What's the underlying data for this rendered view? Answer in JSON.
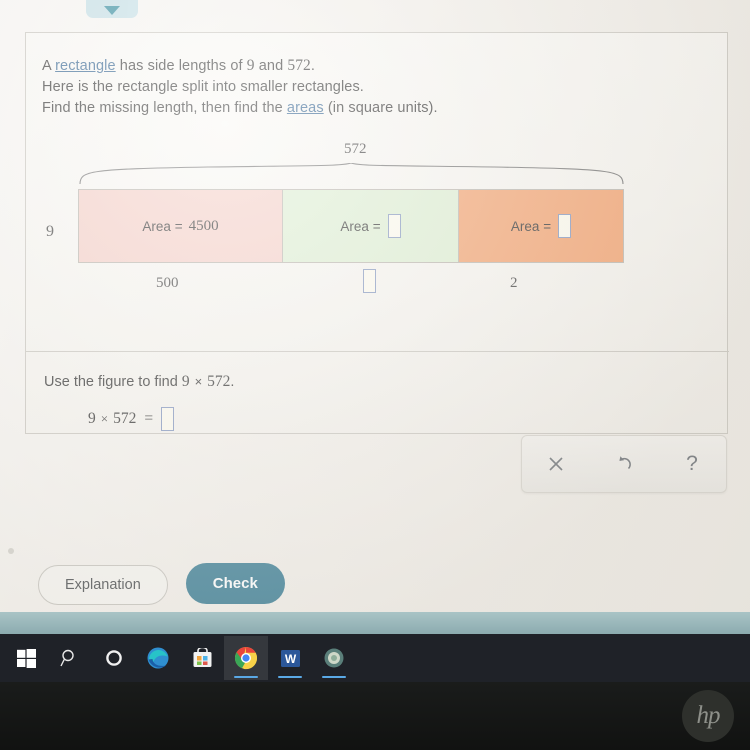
{
  "top_chip": {
    "icon": "chevron-down-icon"
  },
  "question": {
    "line1_a": "A ",
    "line1_link": "rectangle",
    "line1_b": " has side lengths of ",
    "line1_val1": "9",
    "line1_c": " and ",
    "line1_val2": "572",
    "line1_d": ".",
    "line2": "Here is the rectangle split into smaller rectangles.",
    "line3_a": "Find the missing length, then find the ",
    "line3_link": "areas",
    "line3_b": " (in square units)."
  },
  "figure": {
    "top_length": "572",
    "side_length": "9",
    "cells": [
      {
        "color": "#f6cfc7",
        "label": "Area =",
        "value": "4500",
        "has_input": false
      },
      {
        "color": "#ddefd2",
        "label": "Area =",
        "value": "",
        "has_input": true
      },
      {
        "color": "#f3a06c",
        "label": "Area =",
        "value": "",
        "has_input": true
      }
    ],
    "bottom_lengths": [
      {
        "value": "500",
        "has_input": false
      },
      {
        "value": "",
        "has_input": true
      },
      {
        "value": "2",
        "has_input": false
      }
    ]
  },
  "lower": {
    "instruction_a": "Use the figure to find ",
    "instruction_factor1": "9",
    "instruction_times": "×",
    "instruction_factor2": "572",
    "instruction_b": ".",
    "eq_factor1": "9",
    "eq_times": "×",
    "eq_factor2": "572",
    "eq_equals": "=",
    "eq_answer": ""
  },
  "palette": {
    "clear_icon": "close-icon",
    "clear_glyph": "✕",
    "undo_icon": "undo-icon",
    "undo_glyph": "↺",
    "help_icon": "question-mark-icon",
    "help_glyph": "?"
  },
  "actions": {
    "explanation_label": "Explanation",
    "check_label": "Check",
    "check_color": "#3d7f96"
  },
  "taskbar": {
    "items": [
      {
        "name": "start-button",
        "glyph": ""
      },
      {
        "name": "search-icon",
        "glyph": "⚲"
      },
      {
        "name": "cortana-icon",
        "glyph": "○"
      },
      {
        "name": "edge-icon",
        "glyph": "e"
      },
      {
        "name": "microsoft-store-icon",
        "glyph": "▣"
      },
      {
        "name": "chrome-icon",
        "glyph": "●"
      },
      {
        "name": "word-icon",
        "glyph": "W"
      },
      {
        "name": "browser-icon",
        "glyph": "●"
      }
    ]
  },
  "laptop": {
    "brand": "hp"
  }
}
